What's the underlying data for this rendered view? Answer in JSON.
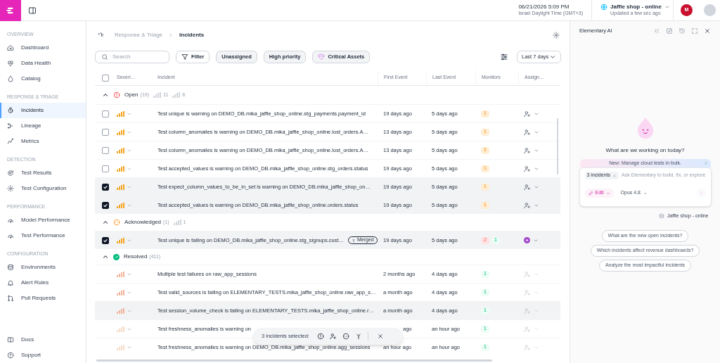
{
  "topbar": {
    "datetime": "06/21/2026 5:09 PM",
    "timezone": "Israel Daylight Time (GMT+3)",
    "environment": "Jaffle shop - online",
    "updated": "Updated a few sec ago",
    "avatar": "M"
  },
  "sidebar": {
    "sections": [
      {
        "title": "OVERVIEW",
        "items": [
          {
            "label": "Dashboard",
            "selected": false
          },
          {
            "label": "Data Health",
            "selected": false
          },
          {
            "label": "Catalog",
            "selected": false
          }
        ]
      },
      {
        "title": "RESPONSE & TRIAGE",
        "items": [
          {
            "label": "Incidents",
            "selected": true
          },
          {
            "label": "Lineage",
            "selected": false
          },
          {
            "label": "Metrics",
            "selected": false
          }
        ]
      },
      {
        "title": "DETECTION",
        "items": [
          {
            "label": "Test Results",
            "selected": false
          },
          {
            "label": "Test Configuration",
            "selected": false
          }
        ]
      },
      {
        "title": "PERFORMANCE",
        "items": [
          {
            "label": "Model Performance",
            "selected": false
          },
          {
            "label": "Test Performance",
            "selected": false
          }
        ]
      },
      {
        "title": "CONFIGURATION",
        "items": [
          {
            "label": "Environments",
            "selected": false
          },
          {
            "label": "Alert Rules",
            "selected": false
          },
          {
            "label": "Pull Requests",
            "selected": false
          }
        ]
      }
    ],
    "footer": [
      {
        "label": "Docs"
      },
      {
        "label": "Support"
      }
    ]
  },
  "breadcrumb": [
    "Response & Triage",
    "Incidents"
  ],
  "toolbar": {
    "search_placeholder": "Search",
    "filters": [
      {
        "label": "Filter",
        "kind": "filter"
      },
      {
        "label": "Unassigned",
        "kind": "chip"
      },
      {
        "label": "High priority",
        "kind": "chip"
      },
      {
        "label": "Critical Assets",
        "kind": "gem"
      }
    ],
    "range": "Last 7 days"
  },
  "table": {
    "all_checked": false,
    "columns": [
      "Severi…",
      "Incident",
      "First Event",
      "Last Event",
      "Monitors",
      "Assign…"
    ],
    "groups": [
      {
        "kind": "open",
        "label": "Open",
        "count": "(19)",
        "severity_counts": [
          "11",
          "8"
        ],
        "rows": [
          {
            "checked": false,
            "color": "#f5a623",
            "incident": "Test unique is warning on DEMO_DB.mika_jaffle_shop_online.stg_payments.payment_id",
            "first_event": "19 days ago",
            "last_event": "5 days ago",
            "monitors": [
              {
                "count": "1",
                "kind": "warning"
              }
            ],
            "assigned": false
          },
          {
            "checked": false,
            "color": "#f5a623",
            "incident": "Test column_anomalies is warning on DEMO_DB.mika_jaffle_shop_online.lost_orders.A…",
            "first_event": "13 days ago",
            "last_event": "5 days ago",
            "monitors": [
              {
                "count": "1",
                "kind": "warning"
              }
            ],
            "assigned": false
          },
          {
            "checked": false,
            "color": "#f5a623",
            "incident": "Test column_anomalies is warning on DEMO_DB.mika_jaffle_shop_online.lost_orders.A…",
            "first_event": "13 days ago",
            "last_event": "5 days ago",
            "monitors": [
              {
                "count": "1",
                "kind": "warning"
              }
            ],
            "assigned": false
          },
          {
            "checked": false,
            "color": "#f5a623",
            "incident": "Test accepted_values is warning on DEMO_DB.mika_jaffle_shop_online.stg_orders.status",
            "first_event": "19 days ago",
            "last_event": "5 days ago",
            "monitors": [
              {
                "count": "1",
                "kind": "warning"
              }
            ],
            "assigned": false
          },
          {
            "checked": true,
            "color": "#f5a623",
            "incident": "Test expect_column_values_to_be_in_set is warning on DEMO_DB.mika_jaffle_shop_on…",
            "first_event": "19 days ago",
            "last_event": "5 days ago",
            "monitors": [
              {
                "count": "1",
                "kind": "warning"
              }
            ],
            "assigned": false
          },
          {
            "checked": true,
            "color": "#f5a623",
            "incident": "Test accepted_values is warning on DEMO_DB.mika_jaffle_shop_online.orders.status",
            "first_event": "19 days ago",
            "last_event": "5 days ago",
            "monitors": [
              {
                "count": "1",
                "kind": "warning"
              }
            ],
            "assigned": false
          }
        ]
      },
      {
        "kind": "acknowledged",
        "label": "Acknowledged",
        "count": "(1)",
        "severity_counts": [
          "1"
        ],
        "rows": [
          {
            "checked": true,
            "color": "#f5a623",
            "incident": "Test unique is failing on DEMO_DB.mika_jaffle_shop_online.stg_signups.cust…",
            "badge": "Merged",
            "first_event": "19 days ago",
            "last_event": "5 days ago",
            "monitors": [
              {
                "count": "2",
                "kind": "error"
              },
              {
                "count": "1",
                "kind": "success"
              }
            ],
            "assigned": true
          }
        ]
      },
      {
        "kind": "resolved",
        "label": "Resolved",
        "count": "(411)",
        "rows": [
          {
            "color": "#f3b49c",
            "incident": "Multiple test failures on raw_app_sessions",
            "first_event": "2 months ago",
            "last_event": "4 days ago",
            "monitors": [
              {
                "count": "1",
                "kind": "success"
              }
            ],
            "assigned": false
          },
          {
            "color": "#f3b49c",
            "incident": "Test valid_sources is failing on ELEMENTARY_TESTS.mika_jaffle_shop_online.raw_app_s…",
            "first_event": "a month ago",
            "last_event": "4 days ago",
            "monitors": [
              {
                "count": "1",
                "kind": "success"
              }
            ],
            "assigned": false
          },
          {
            "color": "#f3b49c",
            "highlighted": true,
            "incident": "Test session_volume_check is failing on ELEMENTARY_TESTS.mika_jaffle_shop_online.r…",
            "first_event": "a month ago",
            "last_event": "4 days ago",
            "monitors": [
              {
                "count": "1",
                "kind": "success"
              }
            ],
            "assigned": false
          },
          {
            "color": "#f7dcc8",
            "incident": "Test freshness_anomalies is warning on",
            "first_event": "ago",
            "first_event_clipped": true,
            "last_event": "an hour ago",
            "monitors": [
              {
                "count": "1",
                "kind": "success"
              }
            ],
            "assigned": false
          },
          {
            "color": "#f7dcc8",
            "incident": "Test freshness_anomalies is warning on DEMO_DB.mika_jaffle_shop_online.agg_sessions",
            "first_event": "an hour ago",
            "last_event": "an hour ago",
            "monitors": [
              {
                "count": "1",
                "kind": "success"
              }
            ],
            "assigned": false
          }
        ]
      }
    ]
  },
  "selection_bar": {
    "label": "3 incidents selected:"
  },
  "ai_panel": {
    "title": "Elementary AI",
    "greeting": "What are we working on today?",
    "banner": "New: Manage cloud tests in bulk.",
    "chip": "3 incidents",
    "placeholder": "Ask Elementary to build, fix, or explore",
    "mode": "Edit",
    "model": "Opus 4.8",
    "environment": "Jaffle shop - online",
    "suggestions": [
      "What are the new open incidents?",
      "Which incidents affect revenue dashboards?",
      "Analyze the most impactful incidents"
    ]
  }
}
